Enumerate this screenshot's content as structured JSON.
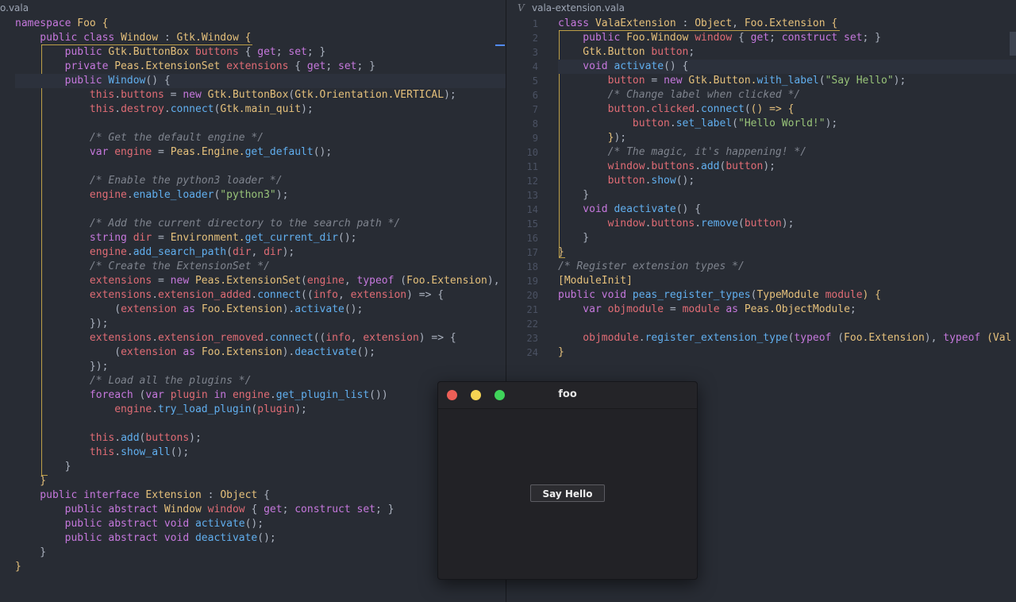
{
  "left_editor": {
    "tab_title": "o.vala",
    "lines": [
      [
        {
          "t": "namespace ",
          "c": "kw"
        },
        {
          "t": "Foo ",
          "c": "ty"
        },
        {
          "t": "{",
          "c": "bc"
        }
      ],
      [
        {
          "t": "    public class ",
          "c": "kw"
        },
        {
          "t": "Window",
          "c": "ty"
        },
        {
          "t": " : ",
          "c": "pl"
        },
        {
          "t": "Gtk.Window",
          "c": "ty"
        },
        {
          "t": " {",
          "c": "bc"
        }
      ],
      [
        {
          "t": "        public ",
          "c": "kw"
        },
        {
          "t": "Gtk.ButtonBox ",
          "c": "ty"
        },
        {
          "t": "buttons ",
          "c": "va"
        },
        {
          "t": "{ ",
          "c": "pl"
        },
        {
          "t": "get",
          "c": "kw"
        },
        {
          "t": "; ",
          "c": "pl"
        },
        {
          "t": "set",
          "c": "kw"
        },
        {
          "t": "; }",
          "c": "pl"
        }
      ],
      [
        {
          "t": "        private ",
          "c": "kw"
        },
        {
          "t": "Peas.ExtensionSet ",
          "c": "ty"
        },
        {
          "t": "extensions ",
          "c": "va"
        },
        {
          "t": "{ ",
          "c": "pl"
        },
        {
          "t": "get",
          "c": "kw"
        },
        {
          "t": "; ",
          "c": "pl"
        },
        {
          "t": "set",
          "c": "kw"
        },
        {
          "t": "; }",
          "c": "pl"
        }
      ],
      [
        {
          "t": "        public ",
          "c": "kw"
        },
        {
          "t": "Window",
          "c": "fn"
        },
        {
          "t": "() {",
          "c": "pl"
        }
      ],
      [
        {
          "t": "            this",
          "c": "va"
        },
        {
          "t": ".",
          "c": "pl"
        },
        {
          "t": "buttons",
          "c": "va"
        },
        {
          "t": " = ",
          "c": "pl"
        },
        {
          "t": "new ",
          "c": "kw"
        },
        {
          "t": "Gtk.ButtonBox",
          "c": "ty"
        },
        {
          "t": "(",
          "c": "pl"
        },
        {
          "t": "Gtk.Orientation.VERTICAL",
          "c": "ty"
        },
        {
          "t": ");",
          "c": "pl"
        }
      ],
      [
        {
          "t": "            this",
          "c": "va"
        },
        {
          "t": ".",
          "c": "pl"
        },
        {
          "t": "destroy",
          "c": "va"
        },
        {
          "t": ".",
          "c": "pl"
        },
        {
          "t": "connect",
          "c": "fn"
        },
        {
          "t": "(",
          "c": "pl"
        },
        {
          "t": "Gtk.main_quit",
          "c": "ty"
        },
        {
          "t": ");",
          "c": "pl"
        }
      ],
      [],
      [
        {
          "t": "            /* Get the default engine */",
          "c": "cm"
        }
      ],
      [
        {
          "t": "            var ",
          "c": "kw"
        },
        {
          "t": "engine",
          "c": "va"
        },
        {
          "t": " = ",
          "c": "pl"
        },
        {
          "t": "Peas.Engine.",
          "c": "ty"
        },
        {
          "t": "get_default",
          "c": "fn"
        },
        {
          "t": "();",
          "c": "pl"
        }
      ],
      [],
      [
        {
          "t": "            /* Enable the python3 loader */",
          "c": "cm"
        }
      ],
      [
        {
          "t": "            engine",
          "c": "va"
        },
        {
          "t": ".",
          "c": "pl"
        },
        {
          "t": "enable_loader",
          "c": "fn"
        },
        {
          "t": "(",
          "c": "pl"
        },
        {
          "t": "\"python3\"",
          "c": "st"
        },
        {
          "t": ");",
          "c": "pl"
        }
      ],
      [],
      [
        {
          "t": "            /* Add the current directory to the search path */",
          "c": "cm"
        }
      ],
      [
        {
          "t": "            string ",
          "c": "kw"
        },
        {
          "t": "dir",
          "c": "va"
        },
        {
          "t": " = ",
          "c": "pl"
        },
        {
          "t": "Environment.",
          "c": "ty"
        },
        {
          "t": "get_current_dir",
          "c": "fn"
        },
        {
          "t": "();",
          "c": "pl"
        }
      ],
      [
        {
          "t": "            engine",
          "c": "va"
        },
        {
          "t": ".",
          "c": "pl"
        },
        {
          "t": "add_search_path",
          "c": "fn"
        },
        {
          "t": "(",
          "c": "pl"
        },
        {
          "t": "dir",
          "c": "va"
        },
        {
          "t": ", ",
          "c": "pl"
        },
        {
          "t": "dir",
          "c": "va"
        },
        {
          "t": ");",
          "c": "pl"
        }
      ],
      [
        {
          "t": "            /* Create the ExtensionSet */",
          "c": "cm"
        }
      ],
      [
        {
          "t": "            extensions",
          "c": "va"
        },
        {
          "t": " = ",
          "c": "pl"
        },
        {
          "t": "new ",
          "c": "kw"
        },
        {
          "t": "Peas.ExtensionSet",
          "c": "ty"
        },
        {
          "t": "(",
          "c": "pl"
        },
        {
          "t": "engine",
          "c": "va"
        },
        {
          "t": ", ",
          "c": "pl"
        },
        {
          "t": "typeof ",
          "c": "kw"
        },
        {
          "t": "(",
          "c": "pl"
        },
        {
          "t": "Foo.Extension",
          "c": "ty"
        },
        {
          "t": "),",
          "c": "pl"
        }
      ],
      [
        {
          "t": "            extensions",
          "c": "va"
        },
        {
          "t": ".",
          "c": "pl"
        },
        {
          "t": "extension_added",
          "c": "va"
        },
        {
          "t": ".",
          "c": "pl"
        },
        {
          "t": "connect",
          "c": "fn"
        },
        {
          "t": "((",
          "c": "pl"
        },
        {
          "t": "info",
          "c": "va"
        },
        {
          "t": ", ",
          "c": "pl"
        },
        {
          "t": "extension",
          "c": "va"
        },
        {
          "t": ") => {",
          "c": "pl"
        }
      ],
      [
        {
          "t": "                (",
          "c": "pl"
        },
        {
          "t": "extension ",
          "c": "va"
        },
        {
          "t": "as ",
          "c": "kw"
        },
        {
          "t": "Foo.Extension",
          "c": "ty"
        },
        {
          "t": ").",
          "c": "pl"
        },
        {
          "t": "activate",
          "c": "fn"
        },
        {
          "t": "();",
          "c": "pl"
        }
      ],
      [
        {
          "t": "            });",
          "c": "pl"
        }
      ],
      [
        {
          "t": "            extensions",
          "c": "va"
        },
        {
          "t": ".",
          "c": "pl"
        },
        {
          "t": "extension_removed",
          "c": "va"
        },
        {
          "t": ".",
          "c": "pl"
        },
        {
          "t": "connect",
          "c": "fn"
        },
        {
          "t": "((",
          "c": "pl"
        },
        {
          "t": "info",
          "c": "va"
        },
        {
          "t": ", ",
          "c": "pl"
        },
        {
          "t": "extension",
          "c": "va"
        },
        {
          "t": ") => {",
          "c": "pl"
        }
      ],
      [
        {
          "t": "                (",
          "c": "pl"
        },
        {
          "t": "extension ",
          "c": "va"
        },
        {
          "t": "as ",
          "c": "kw"
        },
        {
          "t": "Foo.Extension",
          "c": "ty"
        },
        {
          "t": ").",
          "c": "pl"
        },
        {
          "t": "deactivate",
          "c": "fn"
        },
        {
          "t": "();",
          "c": "pl"
        }
      ],
      [
        {
          "t": "            });",
          "c": "pl"
        }
      ],
      [
        {
          "t": "            /* Load all the plugins */",
          "c": "cm"
        }
      ],
      [
        {
          "t": "            foreach ",
          "c": "kw"
        },
        {
          "t": "(",
          "c": "pl"
        },
        {
          "t": "var ",
          "c": "kw"
        },
        {
          "t": "plugin ",
          "c": "va"
        },
        {
          "t": "in ",
          "c": "kw"
        },
        {
          "t": "engine",
          "c": "va"
        },
        {
          "t": ".",
          "c": "pl"
        },
        {
          "t": "get_plugin_list",
          "c": "fn"
        },
        {
          "t": "())",
          "c": "pl"
        }
      ],
      [
        {
          "t": "                engine",
          "c": "va"
        },
        {
          "t": ".",
          "c": "pl"
        },
        {
          "t": "try_load_plugin",
          "c": "fn"
        },
        {
          "t": "(",
          "c": "pl"
        },
        {
          "t": "plugin",
          "c": "va"
        },
        {
          "t": ");",
          "c": "pl"
        }
      ],
      [],
      [
        {
          "t": "            this",
          "c": "va"
        },
        {
          "t": ".",
          "c": "pl"
        },
        {
          "t": "add",
          "c": "fn"
        },
        {
          "t": "(",
          "c": "pl"
        },
        {
          "t": "buttons",
          "c": "va"
        },
        {
          "t": ");",
          "c": "pl"
        }
      ],
      [
        {
          "t": "            this",
          "c": "va"
        },
        {
          "t": ".",
          "c": "pl"
        },
        {
          "t": "show_all",
          "c": "fn"
        },
        {
          "t": "();",
          "c": "pl"
        }
      ],
      [
        {
          "t": "        }",
          "c": "pl"
        }
      ],
      [
        {
          "t": "    }",
          "c": "bc"
        }
      ],
      [
        {
          "t": "    public interface ",
          "c": "kw"
        },
        {
          "t": "Extension",
          "c": "ty"
        },
        {
          "t": " : ",
          "c": "pl"
        },
        {
          "t": "Object",
          "c": "ty"
        },
        {
          "t": " {",
          "c": "pl"
        }
      ],
      [
        {
          "t": "        public abstract ",
          "c": "kw"
        },
        {
          "t": "Window ",
          "c": "ty"
        },
        {
          "t": "window ",
          "c": "va"
        },
        {
          "t": "{ ",
          "c": "pl"
        },
        {
          "t": "get",
          "c": "kw"
        },
        {
          "t": "; ",
          "c": "pl"
        },
        {
          "t": "construct set",
          "c": "kw"
        },
        {
          "t": "; }",
          "c": "pl"
        }
      ],
      [
        {
          "t": "        public abstract void ",
          "c": "kw"
        },
        {
          "t": "activate",
          "c": "fn"
        },
        {
          "t": "();",
          "c": "pl"
        }
      ],
      [
        {
          "t": "        public abstract void ",
          "c": "kw"
        },
        {
          "t": "deactivate",
          "c": "fn"
        },
        {
          "t": "();",
          "c": "pl"
        }
      ],
      [
        {
          "t": "    }",
          "c": "pl"
        }
      ],
      [
        {
          "t": "}",
          "c": "bc"
        }
      ]
    ]
  },
  "right_editor": {
    "tab_title": "vala-extension.vala",
    "line_numbers": [
      "1",
      "2",
      "3",
      "4",
      "5",
      "6",
      "7",
      "8",
      "9",
      "10",
      "11",
      "12",
      "13",
      "14",
      "15",
      "16",
      "17",
      "18",
      "19",
      "20",
      "21",
      "22",
      "23",
      "24"
    ],
    "lines": [
      [
        {
          "t": "class ",
          "c": "kw"
        },
        {
          "t": "ValaExtension",
          "c": "ty"
        },
        {
          "t": " : ",
          "c": "pl"
        },
        {
          "t": "Object",
          "c": "ty"
        },
        {
          "t": ", ",
          "c": "pl"
        },
        {
          "t": "Foo.Extension",
          "c": "ty"
        },
        {
          "t": " {",
          "c": "bc"
        }
      ],
      [
        {
          "t": "    public ",
          "c": "kw"
        },
        {
          "t": "Foo.Window ",
          "c": "ty"
        },
        {
          "t": "window ",
          "c": "va"
        },
        {
          "t": "{ ",
          "c": "pl"
        },
        {
          "t": "get",
          "c": "kw"
        },
        {
          "t": "; ",
          "c": "pl"
        },
        {
          "t": "construct set",
          "c": "kw"
        },
        {
          "t": "; }",
          "c": "pl"
        }
      ],
      [
        {
          "t": "    Gtk.Button ",
          "c": "ty"
        },
        {
          "t": "button",
          "c": "va"
        },
        {
          "t": ";",
          "c": "pl"
        }
      ],
      [
        {
          "t": "    void ",
          "c": "kw"
        },
        {
          "t": "activate",
          "c": "fn"
        },
        {
          "t": "() {",
          "c": "pl"
        }
      ],
      [
        {
          "t": "        button",
          "c": "va"
        },
        {
          "t": " = ",
          "c": "pl"
        },
        {
          "t": "new ",
          "c": "kw"
        },
        {
          "t": "Gtk.Button.",
          "c": "ty"
        },
        {
          "t": "with_label",
          "c": "fn"
        },
        {
          "t": "(",
          "c": "pl"
        },
        {
          "t": "\"Say Hello\"",
          "c": "st"
        },
        {
          "t": ");",
          "c": "pl"
        }
      ],
      [
        {
          "t": "        /* Change label when clicked */",
          "c": "cm"
        }
      ],
      [
        {
          "t": "        button",
          "c": "va"
        },
        {
          "t": ".",
          "c": "pl"
        },
        {
          "t": "clicked",
          "c": "va"
        },
        {
          "t": ".",
          "c": "pl"
        },
        {
          "t": "connect",
          "c": "fn"
        },
        {
          "t": "(",
          "c": "pl"
        },
        {
          "t": "() => {",
          "c": "bc"
        }
      ],
      [
        {
          "t": "            button",
          "c": "va"
        },
        {
          "t": ".",
          "c": "pl"
        },
        {
          "t": "set_label",
          "c": "fn"
        },
        {
          "t": "(",
          "c": "pl"
        },
        {
          "t": "\"Hello World!\"",
          "c": "st"
        },
        {
          "t": ");",
          "c": "pl"
        }
      ],
      [
        {
          "t": "        }",
          "c": "bc"
        },
        {
          "t": ");",
          "c": "pl"
        }
      ],
      [
        {
          "t": "        /* The magic, it's happening! */",
          "c": "cm"
        }
      ],
      [
        {
          "t": "        window",
          "c": "va"
        },
        {
          "t": ".",
          "c": "pl"
        },
        {
          "t": "buttons",
          "c": "va"
        },
        {
          "t": ".",
          "c": "pl"
        },
        {
          "t": "add",
          "c": "fn"
        },
        {
          "t": "(",
          "c": "pl"
        },
        {
          "t": "button",
          "c": "va"
        },
        {
          "t": ");",
          "c": "pl"
        }
      ],
      [
        {
          "t": "        button",
          "c": "va"
        },
        {
          "t": ".",
          "c": "pl"
        },
        {
          "t": "show",
          "c": "fn"
        },
        {
          "t": "();",
          "c": "pl"
        }
      ],
      [
        {
          "t": "    }",
          "c": "pl"
        }
      ],
      [
        {
          "t": "    void ",
          "c": "kw"
        },
        {
          "t": "deactivate",
          "c": "fn"
        },
        {
          "t": "() {",
          "c": "pl"
        }
      ],
      [
        {
          "t": "        window",
          "c": "va"
        },
        {
          "t": ".",
          "c": "pl"
        },
        {
          "t": "buttons",
          "c": "va"
        },
        {
          "t": ".",
          "c": "pl"
        },
        {
          "t": "remove",
          "c": "fn"
        },
        {
          "t": "(",
          "c": "pl"
        },
        {
          "t": "button",
          "c": "va"
        },
        {
          "t": ");",
          "c": "pl"
        }
      ],
      [
        {
          "t": "    }",
          "c": "pl"
        }
      ],
      [
        {
          "t": "}",
          "c": "bc"
        }
      ],
      [
        {
          "t": "/* Register extension types */",
          "c": "cm"
        }
      ],
      [
        {
          "t": "[ModuleInit]",
          "c": "ty"
        }
      ],
      [
        {
          "t": "public void ",
          "c": "kw"
        },
        {
          "t": "peas_register_types",
          "c": "fn"
        },
        {
          "t": "(",
          "c": "pl"
        },
        {
          "t": "TypeModule ",
          "c": "ty"
        },
        {
          "t": "module",
          "c": "va"
        },
        {
          "t": ") {",
          "c": "bc"
        }
      ],
      [
        {
          "t": "    var ",
          "c": "kw"
        },
        {
          "t": "objmodule",
          "c": "va"
        },
        {
          "t": " = ",
          "c": "pl"
        },
        {
          "t": "module ",
          "c": "va"
        },
        {
          "t": "as ",
          "c": "kw"
        },
        {
          "t": "Peas.ObjectModule",
          "c": "ty"
        },
        {
          "t": ";",
          "c": "pl"
        }
      ],
      [],
      [
        {
          "t": "    objmodule",
          "c": "va"
        },
        {
          "t": ".",
          "c": "pl"
        },
        {
          "t": "register_extension_type",
          "c": "fn"
        },
        {
          "t": "(",
          "c": "pl"
        },
        {
          "t": "typeof ",
          "c": "kw"
        },
        {
          "t": "(",
          "c": "pl"
        },
        {
          "t": "Foo.Extension",
          "c": "ty"
        },
        {
          "t": "), ",
          "c": "pl"
        },
        {
          "t": "typeof ",
          "c": "kw"
        },
        {
          "t": "(Val",
          "c": "ty"
        }
      ],
      [
        {
          "t": "}",
          "c": "bc"
        }
      ]
    ]
  },
  "app_window": {
    "title": "foo",
    "button_label": "Say Hello",
    "traffic_lights": {
      "close": "#ed5f57",
      "minimize": "#f5d453",
      "maximize": "#3fd45a"
    }
  }
}
